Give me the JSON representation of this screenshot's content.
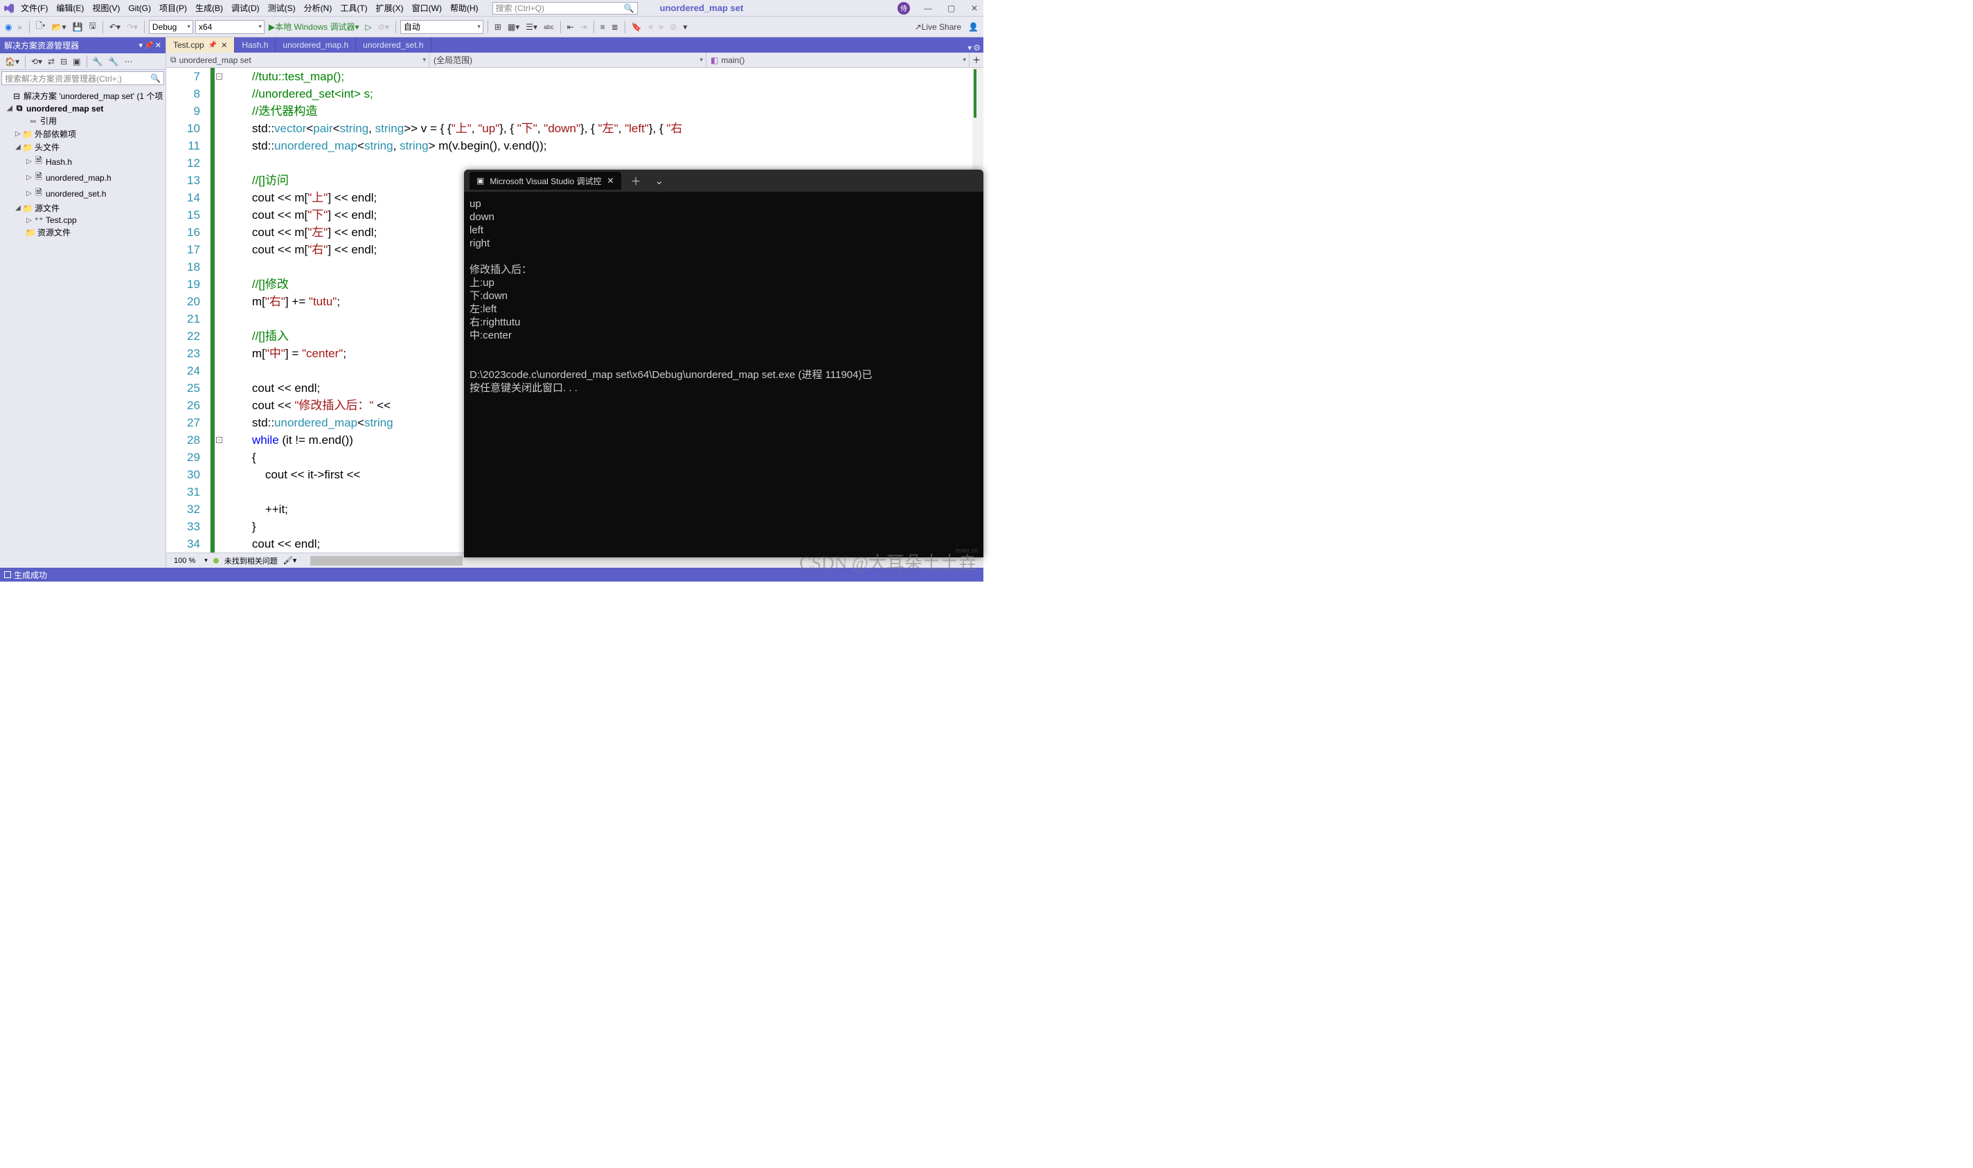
{
  "menu": {
    "items": [
      "文件(F)",
      "编辑(E)",
      "视图(V)",
      "Git(G)",
      "项目(P)",
      "生成(B)",
      "调试(D)",
      "测试(S)",
      "分析(N)",
      "工具(T)",
      "扩展(X)",
      "窗口(W)",
      "帮助(H)"
    ]
  },
  "search_placeholder": "搜索 (Ctrl+Q)",
  "app_title": "unordered_map set",
  "avatar": "侍",
  "toolbar": {
    "config": "Debug",
    "platform": "x64",
    "debugger": "本地 Windows 调试器",
    "auto": "自动",
    "liveshare": "Live Share"
  },
  "sidebar": {
    "title": "解决方案资源管理器",
    "search_placeholder": "搜索解决方案资源管理器(Ctrl+;)",
    "solution": "解决方案 'unordered_map set' (1 个项",
    "project": "unordered_map set",
    "refs": "引用",
    "external": "外部依赖项",
    "headers": "头文件",
    "h1": "Hash.h",
    "h2": "unordered_map.h",
    "h3": "unordered_set.h",
    "sources": "源文件",
    "s1": "Test.cpp",
    "resources": "资源文件"
  },
  "tabs": [
    "Test.cpp",
    "Hash.h",
    "unordered_map.h",
    "unordered_set.h"
  ],
  "nav": {
    "scope1": "unordered_map set",
    "scope2": "(全局范围)",
    "scope3": "main()"
  },
  "code": {
    "start": 7,
    "lines": [
      {
        "t": "//tutu::test_map();",
        "cls": "c-com"
      },
      {
        "t": "//unordered_set<int> s;",
        "cls": "c-com"
      },
      {
        "t": "//迭代器构造",
        "cls": "c-com"
      },
      {
        "html": "std::<span class='c-type'>vector</span>&lt;<span class='c-type'>pair</span>&lt;<span class='c-type'>string</span>, <span class='c-type'>string</span>&gt;&gt; v = { {<span class='c-str'>\"上\"</span>, <span class='c-str'>\"up\"</span>}, { <span class='c-str'>\"下\"</span>, <span class='c-str'>\"down\"</span>}, { <span class='c-str'>\"左\"</span>, <span class='c-str'>\"left\"</span>}, { <span class='c-str'>\"右"
      },
      {
        "html": "std::<span class='c-type'>unordered_map</span>&lt;<span class='c-type'>string</span>, <span class='c-type'>string</span>&gt; m(v.begin(), v.end());"
      },
      {
        "t": ""
      },
      {
        "t": "//[]访问",
        "cls": "c-com"
      },
      {
        "html": "cout &lt;&lt; m[<span class='c-str'>\"上\"</span>] &lt;&lt; endl;"
      },
      {
        "html": "cout &lt;&lt; m[<span class='c-str'>\"下\"</span>] &lt;&lt; endl;"
      },
      {
        "html": "cout &lt;&lt; m[<span class='c-str'>\"左\"</span>] &lt;&lt; endl;"
      },
      {
        "html": "cout &lt;&lt; m[<span class='c-str'>\"右\"</span>] &lt;&lt; endl;"
      },
      {
        "t": ""
      },
      {
        "t": "//[]修改",
        "cls": "c-com"
      },
      {
        "html": "m[<span class='c-str'>\"右\"</span>] += <span class='c-str'>\"tutu\"</span>;"
      },
      {
        "t": ""
      },
      {
        "t": "//[]插入",
        "cls": "c-com"
      },
      {
        "html": "m[<span class='c-str'>\"中\"</span>] = <span class='c-str'>\"center\"</span>;"
      },
      {
        "t": ""
      },
      {
        "html": "cout &lt;&lt; endl;"
      },
      {
        "html": "cout &lt;&lt; <span class='c-str'>\"修改插入后：\"</span> &lt;&lt;"
      },
      {
        "html": "std::<span class='c-type'>unordered_map</span>&lt;<span class='c-type'>string</span>"
      },
      {
        "html": "<span class='c-kw'>while</span> (it != m.end())"
      },
      {
        "t": "{"
      },
      {
        "html": "    cout &lt;&lt; it-&gt;first &lt;&lt;"
      },
      {
        "t": ""
      },
      {
        "t": "    ++it;"
      },
      {
        "t": "}"
      },
      {
        "html": "cout &lt;&lt; endl;"
      }
    ]
  },
  "zoom": "100 %",
  "issues": "未找到相关问题",
  "status": "生成成功",
  "console": {
    "title": "Microsoft Visual Studio 调试控",
    "out": "up\ndown\nleft\nright\n\n修改插入后：\n上:up\n下:down\n左:left\n右:righttutu\n中:center\n\n\nD:\\2023code.c\\unordered_map set\\x64\\Debug\\unordered_map set.exe (进程 111904)已\n按任意键关闭此窗口. . ."
  },
  "watermark": "CSDN @大耳朵土土垚",
  "watermark2": "znwx.cn"
}
